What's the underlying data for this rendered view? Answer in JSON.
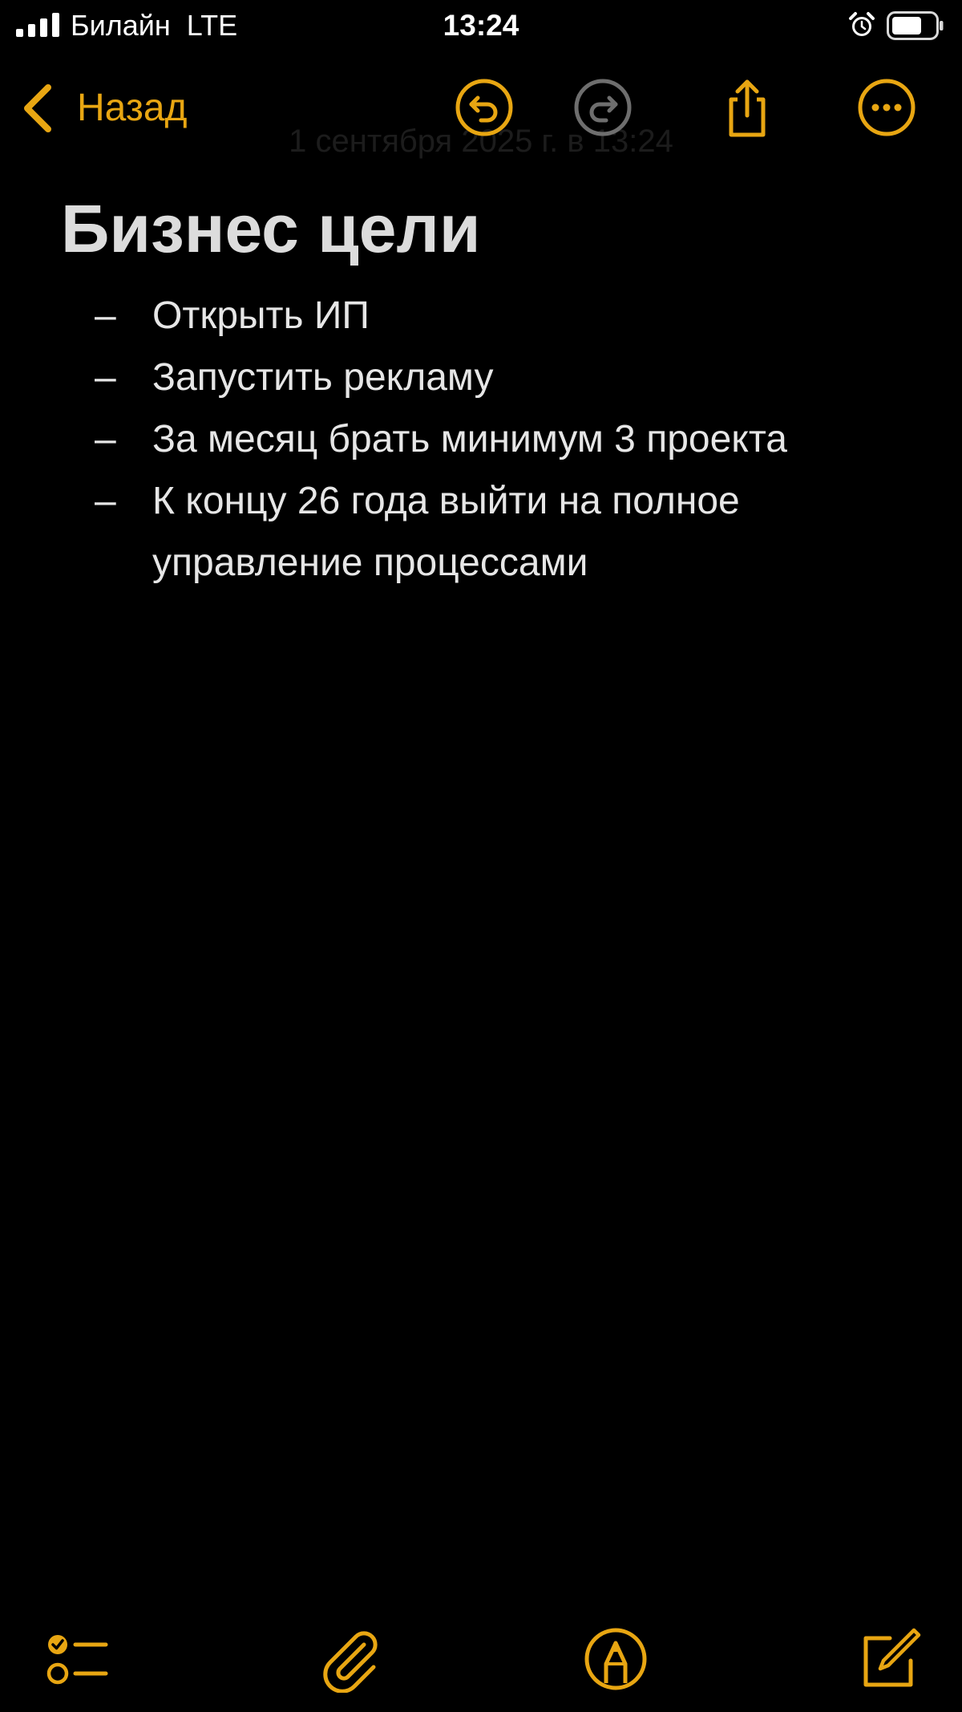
{
  "status_bar": {
    "carrier": "Билайн  LTE",
    "time": "13:24",
    "icons": {
      "signal": "signal-bars-icon",
      "alarm": "alarm-clock-icon",
      "battery": "battery-icon"
    }
  },
  "nav": {
    "back_label": "Назад",
    "faded_date": "1 сентября 2025 г. в 13:24",
    "icons": [
      "chevron-left-icon",
      "undo-icon",
      "redo-icon",
      "share-icon",
      "more-icon"
    ]
  },
  "note": {
    "title": "Бизнес цели",
    "dash": "–",
    "items": [
      "Открыть ИП",
      "Запустить рекламу",
      "За месяц брать минимум 3 проекта",
      "К концу 26 года выйти на полное управление процессами"
    ]
  },
  "toolbar": {
    "icons": [
      "checklist-icon",
      "paperclip-icon",
      "markup-pen-icon",
      "compose-icon"
    ]
  },
  "colors": {
    "accent": "#e8a612",
    "background": "#000000",
    "text": "#e6e6e6",
    "title": "#dcdcdc",
    "disabled": "#6e6e6e"
  }
}
